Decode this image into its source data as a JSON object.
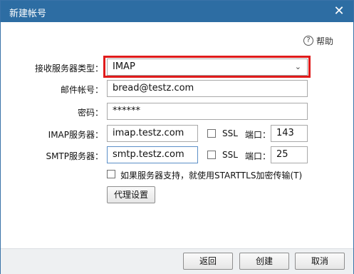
{
  "window": {
    "title": "新建帐号",
    "close_glyph": "✕"
  },
  "help": {
    "label": "帮助",
    "glyph": "?"
  },
  "form": {
    "server_type": {
      "label": "接收服务器类型：",
      "value": "IMAP",
      "arrow": "⌄"
    },
    "account": {
      "label": "邮件帐号：",
      "value": "bread@testz.com"
    },
    "password": {
      "label": "密码：",
      "value": "******"
    },
    "imap": {
      "label": "IMAP服务器：",
      "value": "imap.testz.com",
      "ssl_label": "SSL",
      "port_label": "端口：",
      "port": "143",
      "ssl_checked": false
    },
    "smtp": {
      "label": "SMTP服务器：",
      "value": "smtp.testz.com",
      "ssl_label": "SSL",
      "port_label": "端口：",
      "port": "25",
      "ssl_checked": false
    },
    "starttls": {
      "label": "如果服务器支持，就使用STARTTLS加密传输(T)",
      "checked": false
    },
    "proxy_button": "代理设置"
  },
  "footer": {
    "back": "返回",
    "create": "创建",
    "cancel": "取消"
  },
  "colors": {
    "titlebar": "#2d6da3",
    "highlight": "#e01b1b",
    "footer_bg": "#eef0f2"
  }
}
